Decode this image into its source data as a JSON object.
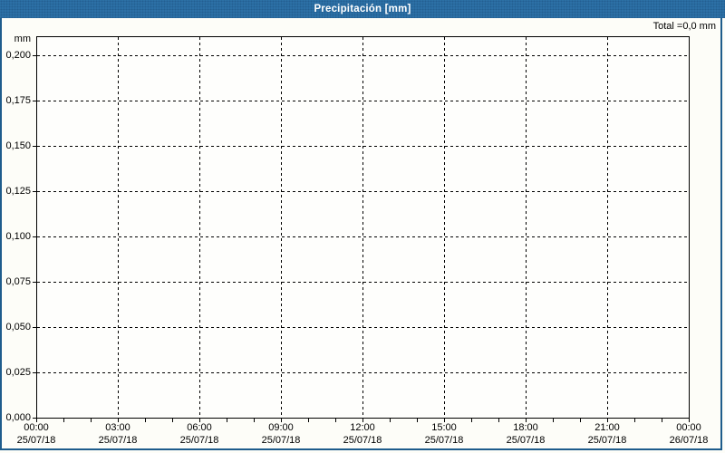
{
  "window": {
    "title": "Precipitación [mm]"
  },
  "chart_data": {
    "type": "line",
    "title": "Precipitación [mm]",
    "y_axis": {
      "unit_label": "mm",
      "tick_labels": [
        "0,200",
        "0,175",
        "0,150",
        "0,125",
        "0,100",
        "0,075",
        "0,050",
        "0,025",
        "0,000"
      ],
      "range": [
        0,
        0.21
      ],
      "major_step": 0.025
    },
    "x_axis": {
      "tick_labels": [
        {
          "time": "00:00",
          "date": "25/07/18"
        },
        {
          "time": "03:00",
          "date": "25/07/18"
        },
        {
          "time": "06:00",
          "date": "25/07/18"
        },
        {
          "time": "09:00",
          "date": "25/07/18"
        },
        {
          "time": "12:00",
          "date": "25/07/18"
        },
        {
          "time": "15:00",
          "date": "25/07/18"
        },
        {
          "time": "18:00",
          "date": "25/07/18"
        },
        {
          "time": "21:00",
          "date": "25/07/18"
        },
        {
          "time": "00:00",
          "date": "26/07/18"
        }
      ],
      "major_step_hours": 3,
      "minor_tick_hours": 1
    },
    "series": [
      {
        "name": "Precipitación [mm]",
        "values": []
      }
    ],
    "annotations": {
      "total_label": "Total =0,0 mm",
      "total_value_mm": 0.0
    },
    "grid": true,
    "legend_position": "none"
  },
  "colors": {
    "title_bar": "#2c70a6",
    "frame_border": "#1e5c8c",
    "grid_lines": "#000000",
    "title_text": "#ffffff",
    "label_text": "#000000",
    "background": "#fdfdf8"
  }
}
